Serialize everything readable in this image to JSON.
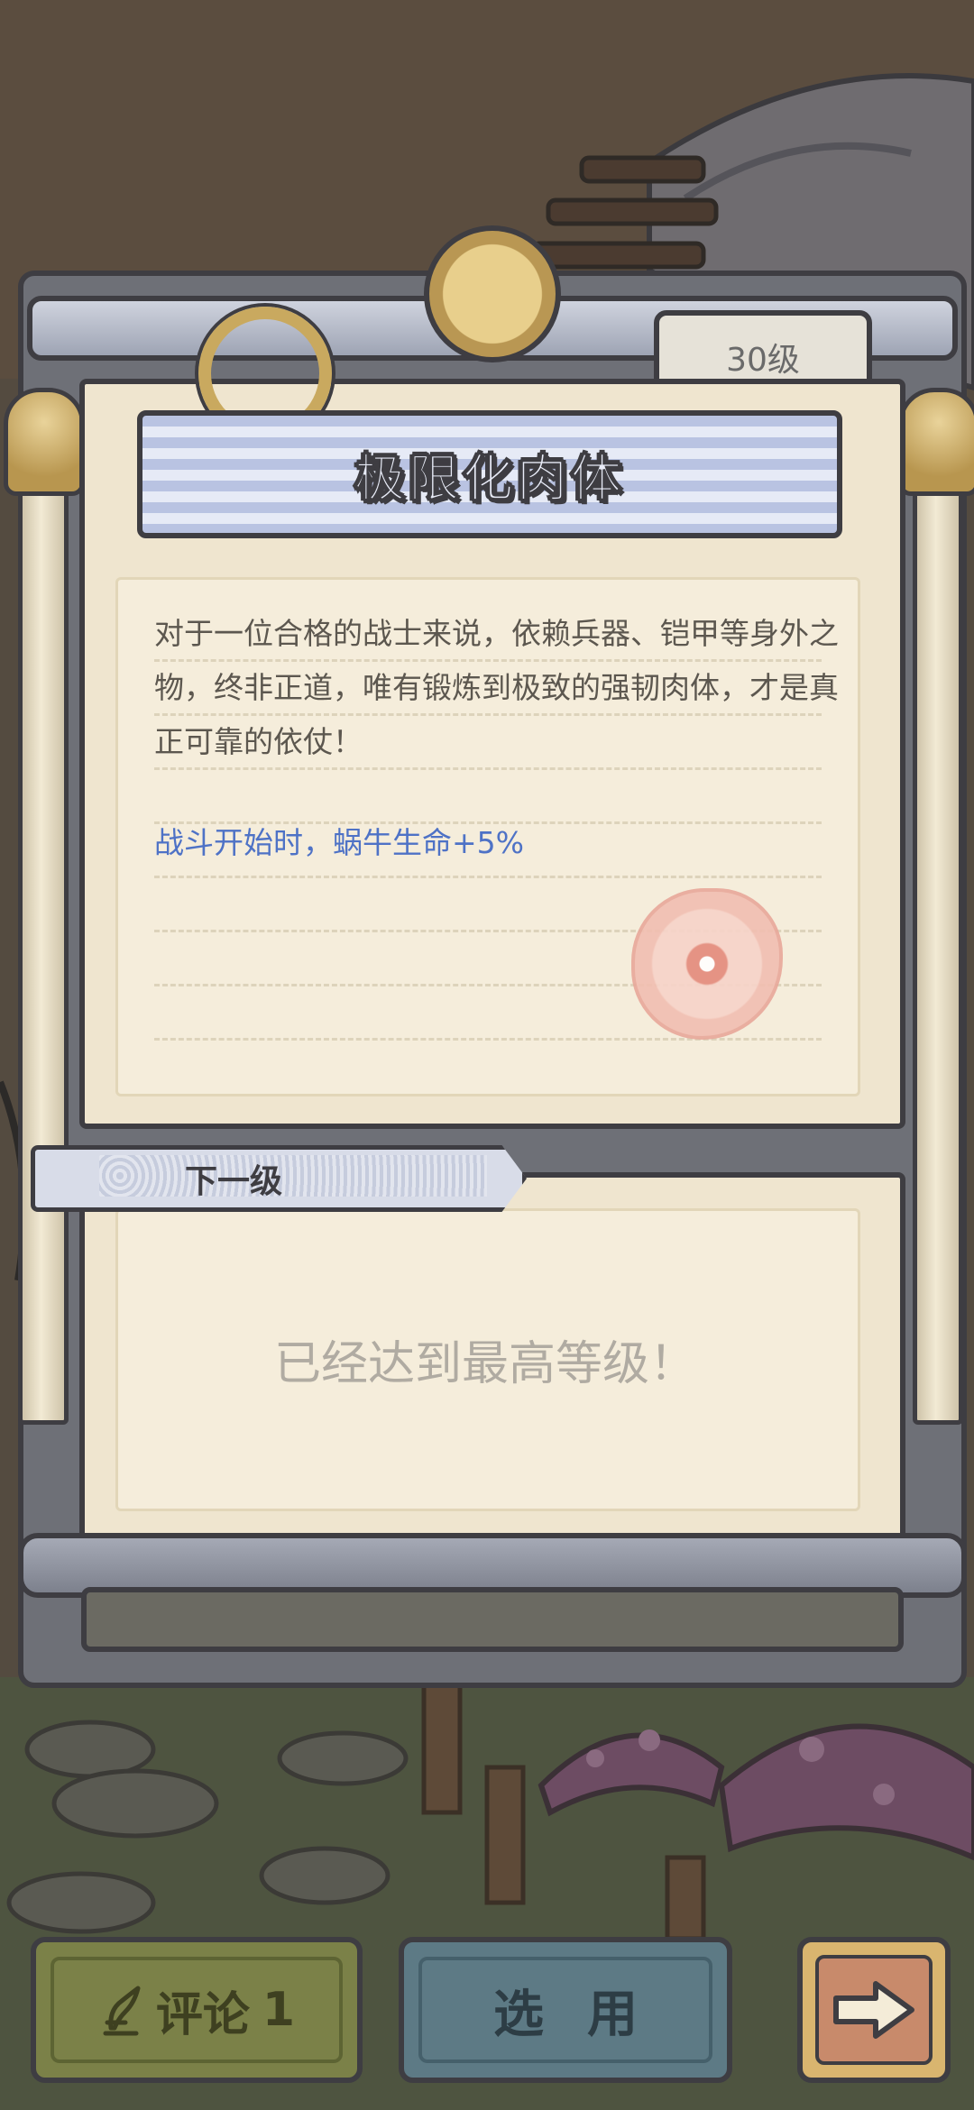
{
  "panel": {
    "level_badge": "30级",
    "title": "极限化肉体",
    "description": "对于一位合格的战士来说，依赖兵器、铠甲等身外之物，终非正道，唯有锻炼到极致的强韧肉体，才是真正可靠的依仗！",
    "effect": "战斗开始时，蜗牛生命+5%",
    "next_level_label": "下一级",
    "next_level_text": "已经达到最高等级！"
  },
  "buttons": {
    "comment_label": "评论",
    "comment_count": "1",
    "select_label": "选用",
    "next_icon": "arrow-right-icon",
    "comment_icon": "quill-pen-icon"
  },
  "colors": {
    "effect_text": "#4e72c6",
    "paper": "#efe5cf",
    "outline": "#3e3d42",
    "comment_button": "#7b8148",
    "select_button": "#5d7a85"
  }
}
